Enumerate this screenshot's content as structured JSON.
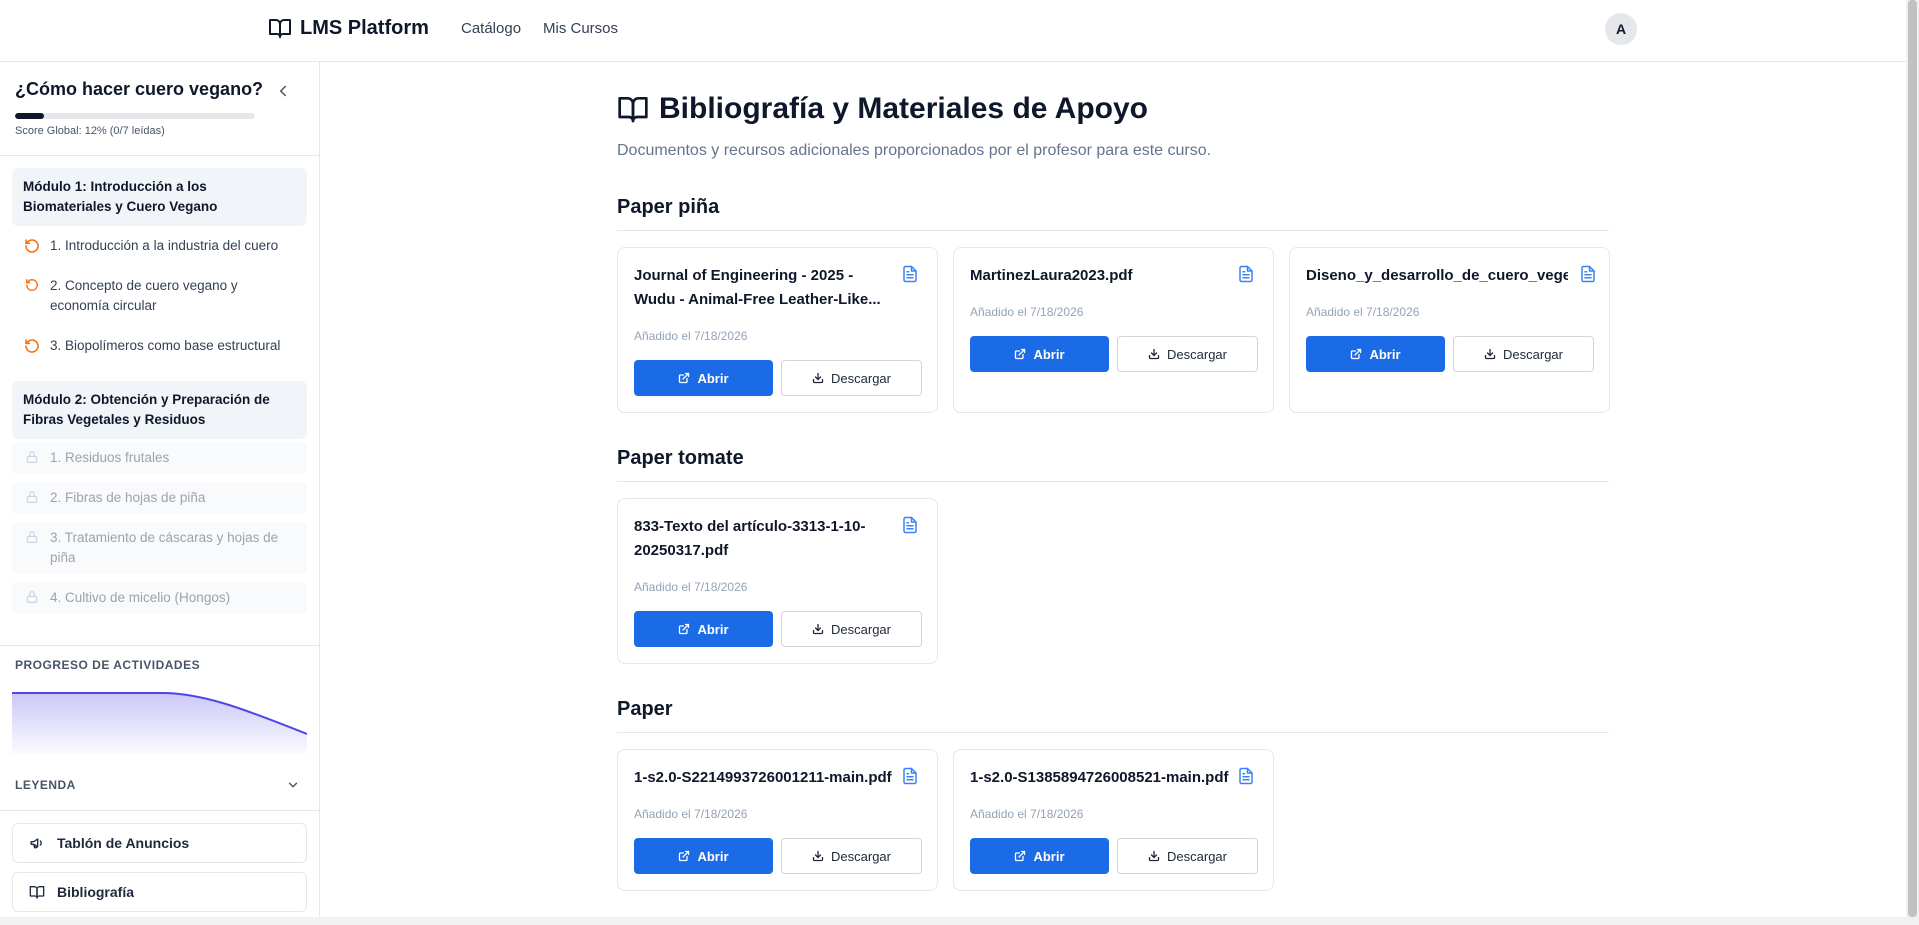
{
  "nav": {
    "brand": "LMS Platform",
    "links": [
      "Catálogo",
      "Mis Cursos"
    ],
    "avatar": "A"
  },
  "sidebar": {
    "course_title": "¿Cómo hacer cuero vegano?",
    "progress_fraction": 0.12,
    "score_text": "Score Global: 12% (0/7 leídas)",
    "modules": [
      {
        "title": "Módulo 1: Introducción a los Biomateriales y Cuero Vegano",
        "lessons": [
          {
            "label": "1. Introducción a la industria del cuero",
            "state": "in-progress"
          },
          {
            "label": "2. Concepto de cuero vegano y economía circular",
            "state": "in-progress"
          },
          {
            "label": "3. Biopolímeros como base estructural",
            "state": "in-progress"
          }
        ]
      },
      {
        "title": "Módulo 2: Obtención y Preparación de Fibras Vegetales y Residuos",
        "lessons": [
          {
            "label": "1. Residuos frutales",
            "state": "locked"
          },
          {
            "label": "2. Fibras de hojas de piña",
            "state": "locked"
          },
          {
            "label": "3. Tratamiento de cáscaras y hojas de piña",
            "state": "locked"
          },
          {
            "label": "4. Cultivo de micelio (Hongos)",
            "state": "locked"
          }
        ]
      }
    ],
    "activity_label": "PROGRESO DE ACTIVIDADES",
    "legend_label": "LEYENDA",
    "quick_links": [
      "Tablón de Anuncios",
      "Bibliografía"
    ]
  },
  "main": {
    "title": "Bibliografía y Materiales de Apoyo",
    "subtitle": "Documentos y recursos adicionales proporcionados por el profesor para este curso.",
    "open_label": "Abrir",
    "download_label": "Descargar",
    "groups": [
      {
        "title": "Paper piña",
        "files": [
          {
            "name": "Journal of Engineering - 2025 - Wudu - Animal-Free Leather-Like...",
            "date": "Añadido el 7/18/2026"
          },
          {
            "name": "MartinezLaura2023.pdf",
            "date": "Añadido el 7/18/2026"
          },
          {
            "name": "Diseno_y_desarrollo_de_cuero_vegeta",
            "date": "Añadido el 7/18/2026"
          }
        ]
      },
      {
        "title": "Paper tomate",
        "files": [
          {
            "name": "833-Texto del artículo-3313-1-10-20250317.pdf",
            "date": "Añadido el 7/18/2026"
          }
        ]
      },
      {
        "title": "Paper",
        "files": [
          {
            "name": "1-s2.0-S2214993726001211-main.pdf",
            "date": "Añadido el 7/18/2026"
          },
          {
            "name": "1-s2.0-S1385894726008521-main.pdf",
            "date": "Añadido el 7/18/2026"
          }
        ]
      }
    ]
  },
  "colors": {
    "primary": "#1a6be5",
    "accent_orange": "#f97316",
    "chart_line": "#4f46e5",
    "text_dark": "#0f172a"
  },
  "icons": {
    "brand": "book-open-icon",
    "lesson_in_progress": "rotate-ccw-icon",
    "lesson_locked": "lock-icon",
    "file": "file-text-icon",
    "open": "external-link-icon",
    "download": "download-icon"
  }
}
